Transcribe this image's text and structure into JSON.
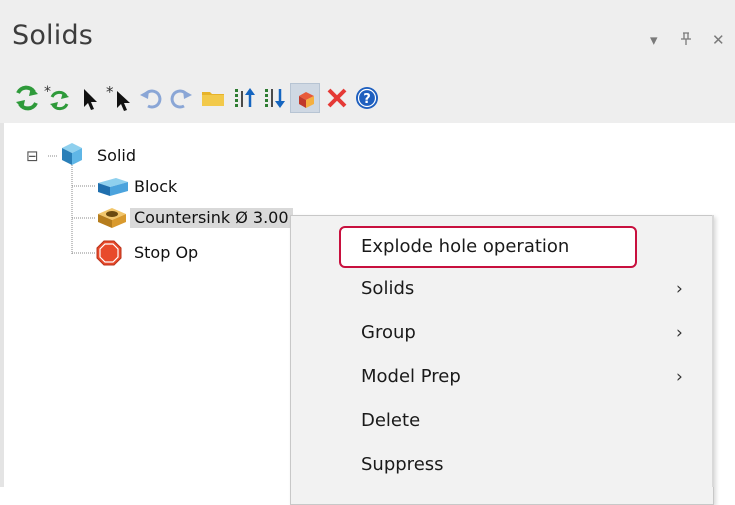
{
  "panel": {
    "title": "Solids",
    "dropdown_glyph": "▾",
    "pin_glyph": "⊥",
    "close_glyph": "✕"
  },
  "toolbar": {
    "icons": [
      "regenerate-all-icon",
      "regenerate-dirty-icon",
      "select-icon",
      "select-multiple-icon",
      "undo-icon",
      "redo-icon",
      "folder-icon",
      "move-up-icon",
      "move-down-icon",
      "solid-view-icon",
      "delete-icon",
      "help-icon"
    ]
  },
  "tree": {
    "expander": "⊟",
    "root": "Solid",
    "children": [
      "Block",
      "Countersink Ø 3.00",
      "Stop Op"
    ]
  },
  "context_menu": {
    "items": [
      {
        "label": "Explode hole operation",
        "submenu": false,
        "highlighted": true
      },
      {
        "label": "Solids",
        "submenu": true
      },
      {
        "label": "Group",
        "submenu": true
      },
      {
        "label": "Model Prep",
        "submenu": true
      },
      {
        "label": "Delete",
        "submenu": false
      },
      {
        "label": "Suppress",
        "submenu": false
      }
    ],
    "submenu_arrow": "›"
  },
  "colors": {
    "highlight_border": "#c8103e",
    "header_bg": "#eeeeee",
    "menu_bg": "#f2f2f2"
  }
}
